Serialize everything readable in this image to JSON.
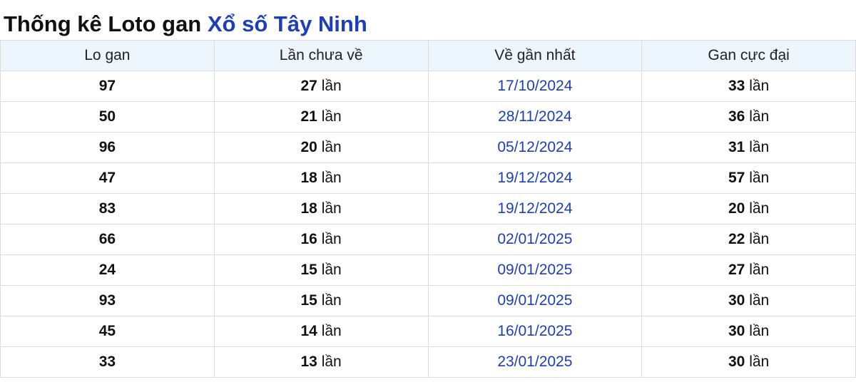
{
  "heading": {
    "prefix": "Thống kê Loto gan",
    "link": "Xổ số Tây Ninh"
  },
  "table": {
    "columns": [
      "Lo gan",
      "Lần chưa về",
      "Về gần nhất",
      "Gan cực đại"
    ],
    "rows": [
      {
        "number": "97",
        "misses": "27",
        "last": "17/10/2024",
        "max": "33"
      },
      {
        "number": "50",
        "misses": "21",
        "last": "28/11/2024",
        "max": "36"
      },
      {
        "number": "96",
        "misses": "20",
        "last": "05/12/2024",
        "max": "31"
      },
      {
        "number": "47",
        "misses": "18",
        "last": "19/12/2024",
        "max": "57"
      },
      {
        "number": "83",
        "misses": "18",
        "last": "19/12/2024",
        "max": "20"
      },
      {
        "number": "66",
        "misses": "16",
        "last": "02/01/2025",
        "max": "22"
      },
      {
        "number": "24",
        "misses": "15",
        "last": "09/01/2025",
        "max": "27"
      },
      {
        "number": "93",
        "misses": "15",
        "last": "09/01/2025",
        "max": "30"
      },
      {
        "number": "45",
        "misses": "14",
        "last": "16/01/2025",
        "max": "30"
      },
      {
        "number": "33",
        "misses": "13",
        "last": "23/01/2025",
        "max": "30"
      }
    ],
    "unit": "lần"
  },
  "colors": {
    "link": "#1c3fb7",
    "header_bg": "#eef6fd",
    "border": "#dcdcdc"
  }
}
